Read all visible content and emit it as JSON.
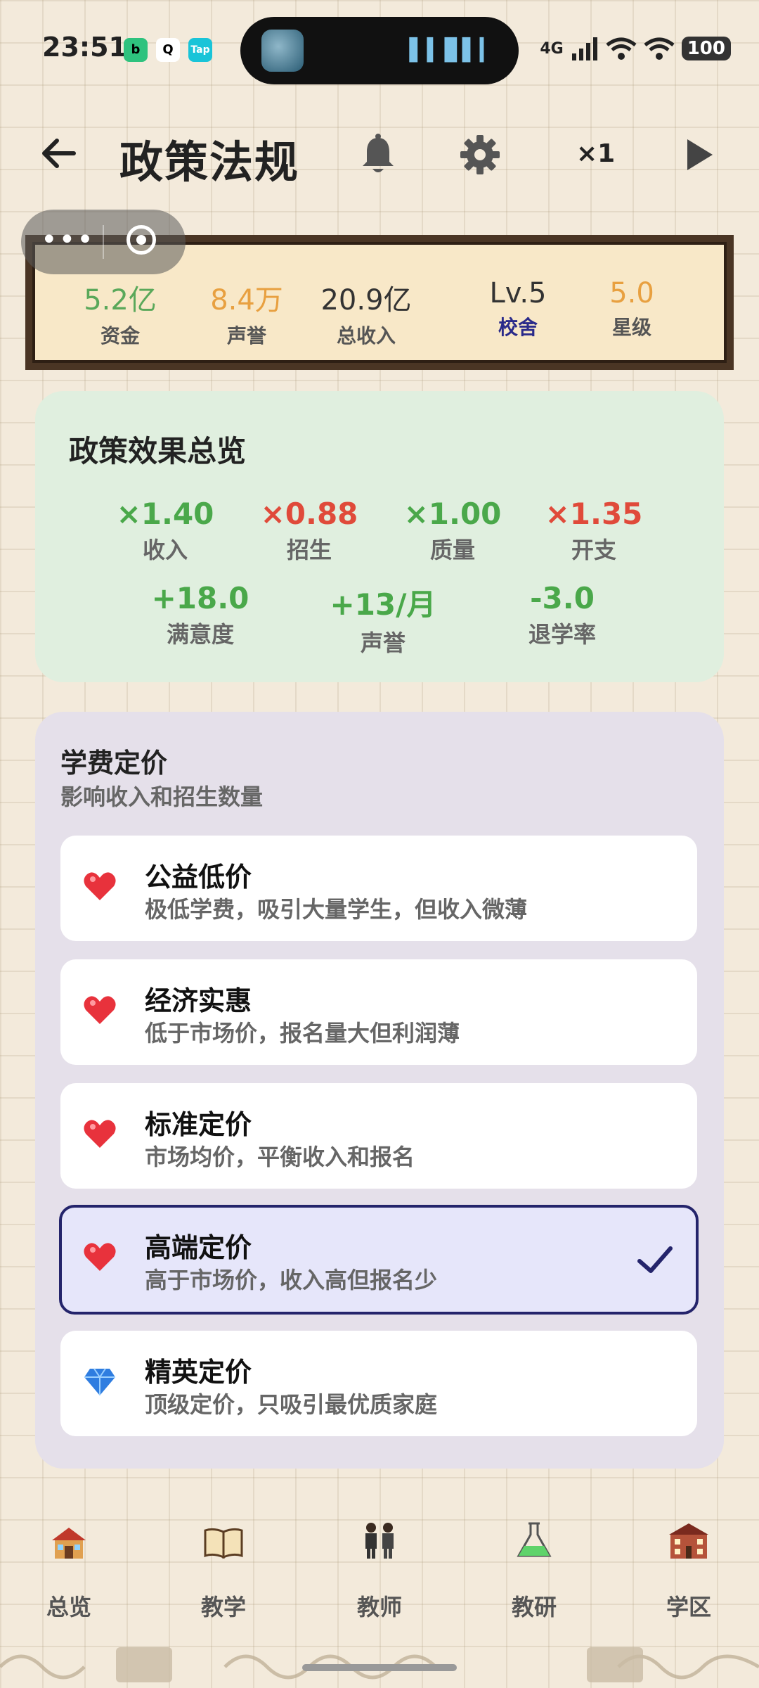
{
  "status_bar": {
    "time": "23:51",
    "apps": [
      "b",
      "Q",
      "Tap"
    ],
    "network": "4G",
    "battery": "100"
  },
  "header": {
    "title": "政策法规",
    "speed": "×1"
  },
  "stats": [
    {
      "value": "5.2亿",
      "label": "资金",
      "color": "#5aa85a"
    },
    {
      "value": "8.4万",
      "label": "声誉",
      "color": "#e8a040"
    },
    {
      "value": "20.9亿",
      "label": "总收入",
      "color": "#333333"
    },
    {
      "value": "Lv.5",
      "label": "校舍",
      "color": "#333333",
      "label_color": "#2a2a8a"
    },
    {
      "value": "5.0",
      "label": "星级",
      "color": "#e8a040"
    }
  ],
  "overview": {
    "title": "政策效果总览",
    "row1": [
      {
        "value": "×1.40",
        "label": "收入",
        "color": "#4aa84a"
      },
      {
        "value": "×0.88",
        "label": "招生",
        "color": "#e04a3a"
      },
      {
        "value": "×1.00",
        "label": "质量",
        "color": "#4aa84a"
      },
      {
        "value": "×1.35",
        "label": "开支",
        "color": "#e04a3a"
      }
    ],
    "row2": [
      {
        "value": "+18.0",
        "label": "满意度",
        "color": "#4aa84a"
      },
      {
        "value": "+13/月",
        "label": "声誉",
        "color": "#4aa84a"
      },
      {
        "value": "-3.0",
        "label": "退学率",
        "color": "#4aa84a"
      }
    ]
  },
  "pricing": {
    "title": "学费定价",
    "subtitle": "影响收入和招生数量",
    "options": [
      {
        "name": "公益低价",
        "desc": "极低学费，吸引大量学生，但收入微薄",
        "icon": "heart-icon",
        "selected": false
      },
      {
        "name": "经济实惠",
        "desc": "低于市场价，报名量大但利润薄",
        "icon": "heart-icon",
        "selected": false
      },
      {
        "name": "标准定价",
        "desc": "市场均价，平衡收入和报名",
        "icon": "heart-icon",
        "selected": false
      },
      {
        "name": "高端定价",
        "desc": "高于市场价，收入高但报名少",
        "icon": "heart-icon",
        "selected": true
      },
      {
        "name": "精英定价",
        "desc": "顶级定价，只吸引最优质家庭",
        "icon": "diamond-icon",
        "selected": false
      }
    ]
  },
  "nav": [
    {
      "label": "总览",
      "icon": "house-icon"
    },
    {
      "label": "教学",
      "icon": "book-icon"
    },
    {
      "label": "教师",
      "icon": "teachers-icon"
    },
    {
      "label": "教研",
      "icon": "flask-icon"
    },
    {
      "label": "学区",
      "icon": "school-icon"
    }
  ]
}
